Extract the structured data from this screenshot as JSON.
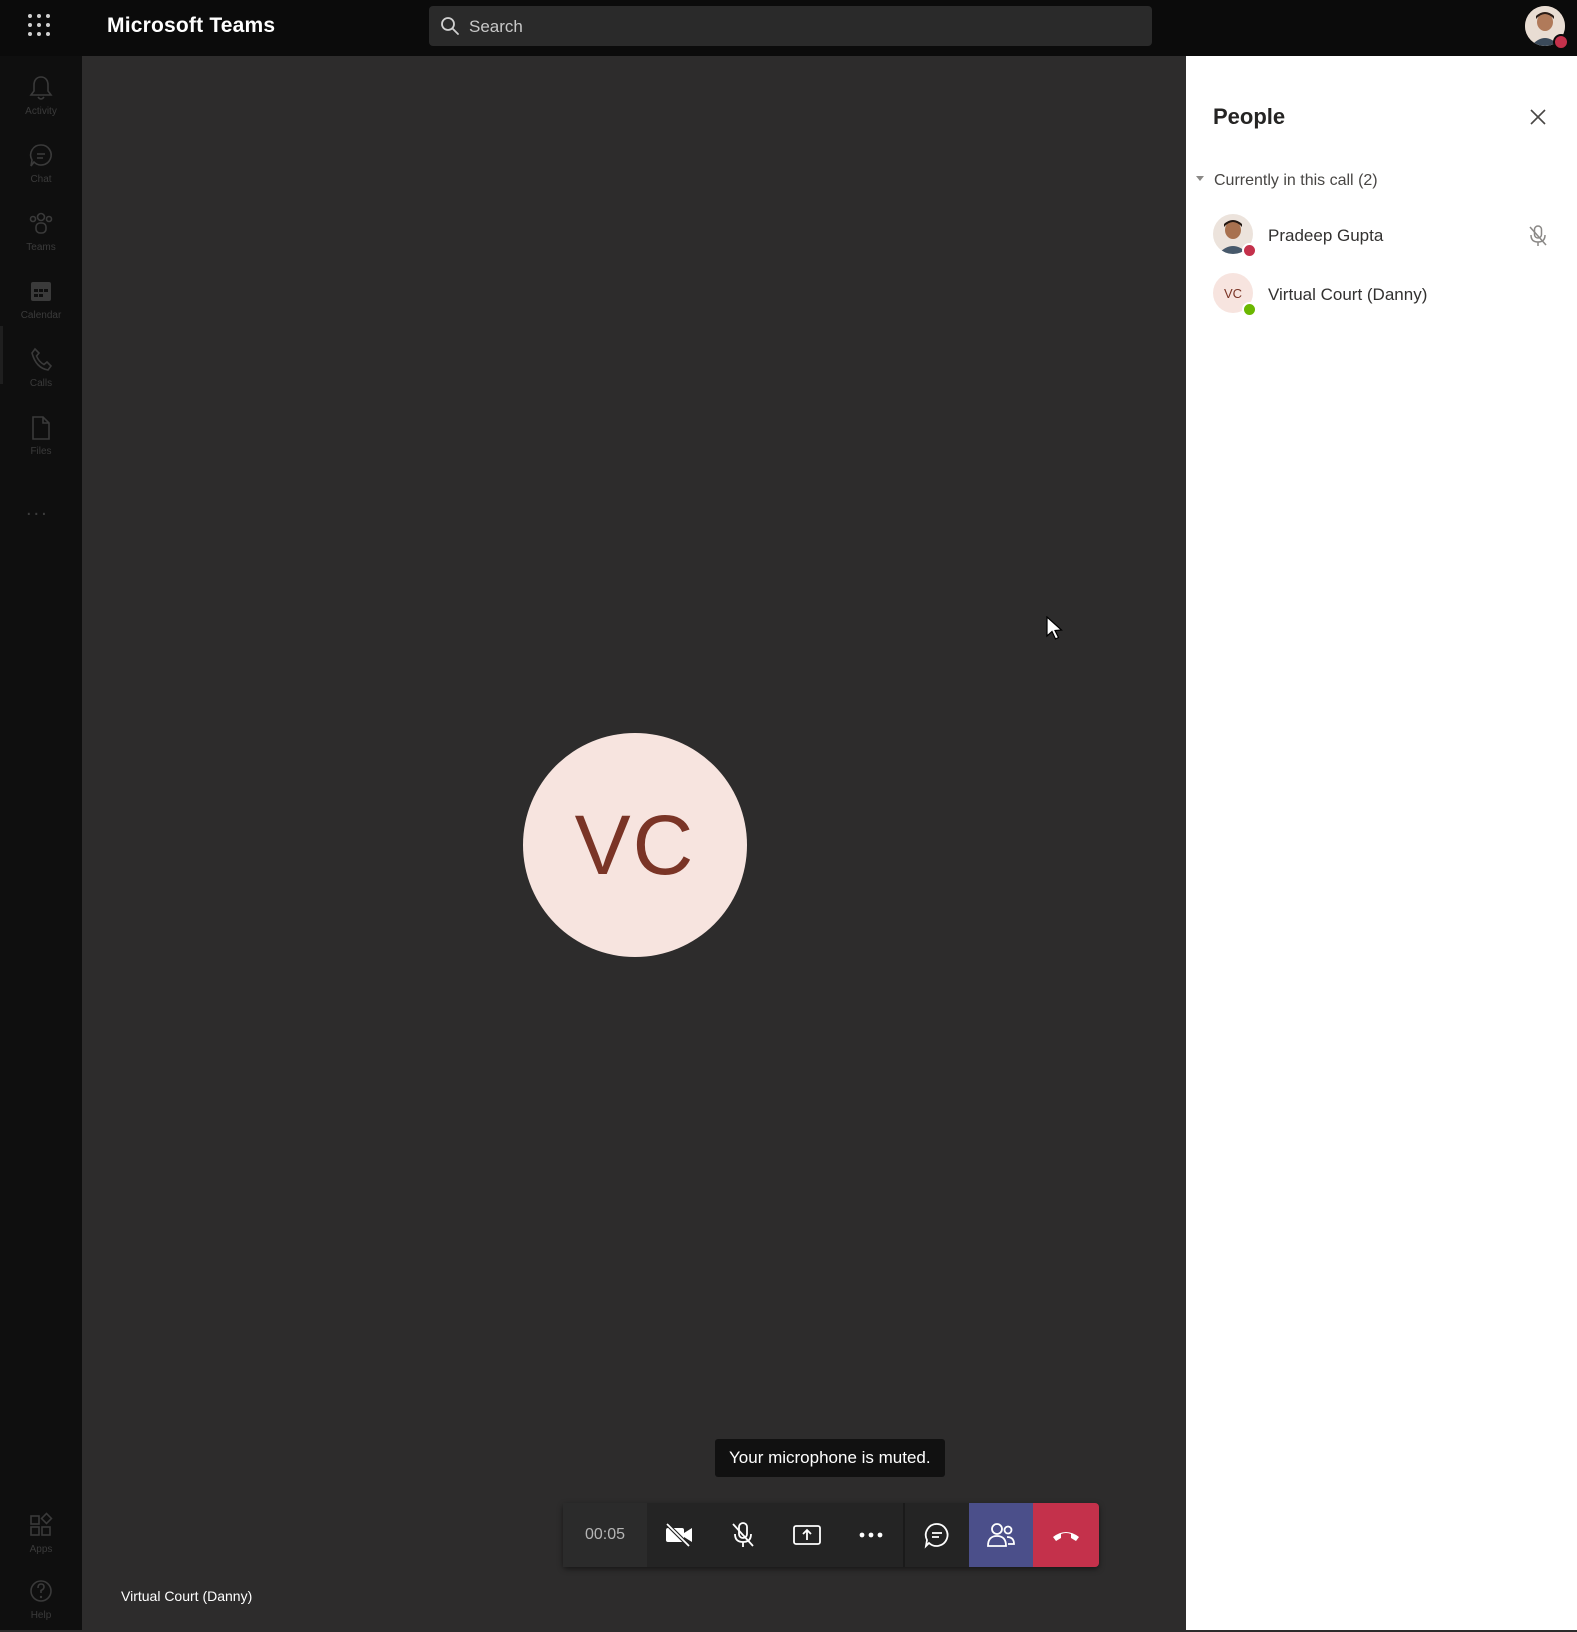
{
  "app": {
    "title": "Microsoft Teams"
  },
  "search": {
    "placeholder": "Search"
  },
  "rail": {
    "items": [
      {
        "label": "Activity",
        "icon": "bell-icon"
      },
      {
        "label": "Chat",
        "icon": "chat-icon"
      },
      {
        "label": "Teams",
        "icon": "teams-icon"
      },
      {
        "label": "Calendar",
        "icon": "calendar-icon"
      },
      {
        "label": "Calls",
        "icon": "phone-icon"
      },
      {
        "label": "Files",
        "icon": "file-icon"
      }
    ],
    "more": "...",
    "bottom": [
      {
        "label": "Apps",
        "icon": "apps-icon"
      },
      {
        "label": "Help",
        "icon": "help-icon"
      }
    ]
  },
  "stage": {
    "participant_initials": "VC",
    "participant_name": "Virtual Court (Danny)",
    "avatar_bg": "#f7e4df",
    "avatar_fg": "#7a3426"
  },
  "toast": {
    "text": "Your microphone is muted."
  },
  "callbar": {
    "timer": "00:05",
    "buttons": [
      "camera-off-icon",
      "mic-off-icon",
      "share-screen-icon",
      "more-icon",
      "chat-icon",
      "people-icon",
      "hang-up-icon"
    ],
    "people_active_color": "#4b4f8a",
    "hangup_color": "#c4314b"
  },
  "panel": {
    "title": "People",
    "section": "Currently in this call",
    "count": "(2)",
    "participants": [
      {
        "name": "Pradeep Gupta",
        "presence": "busy",
        "presence_color": "#c4314b",
        "muted": true
      },
      {
        "name": "Virtual Court (Danny)",
        "initials": "VC",
        "presence": "available",
        "presence_color": "#6bb700",
        "muted": false
      }
    ]
  }
}
